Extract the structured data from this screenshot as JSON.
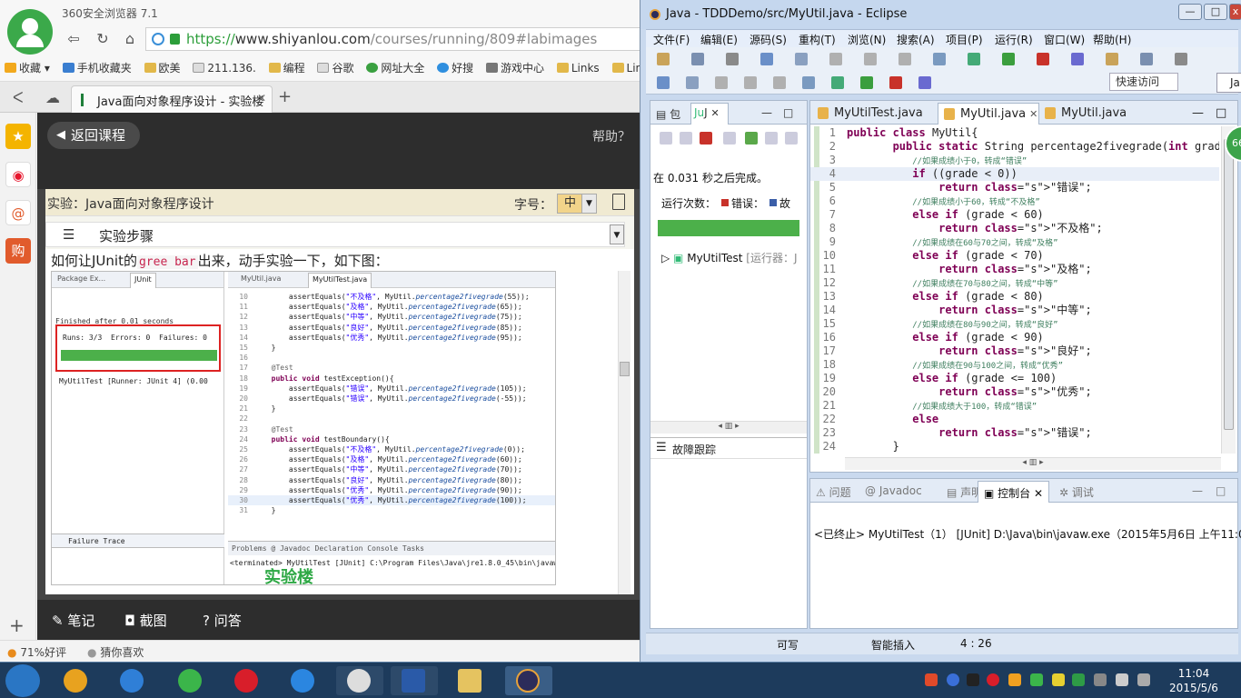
{
  "browser": {
    "app_name": "360安全浏览器 7.1",
    "url": {
      "scheme": "https://",
      "host": "www.shiyanlou.com",
      "path": "/courses/running/809#labimages"
    },
    "bookmarks": [
      "收藏",
      "手机收藏夹",
      "欧美",
      "211.136.",
      "编程",
      "谷歌",
      "网址大全",
      "好搜",
      "游戏中心",
      "Links",
      "Link"
    ],
    "tab_title": "Java面向对象程序设计 - 实验楼",
    "status": {
      "rating": "71%好评",
      "guess": "猜你喜欢"
    }
  },
  "page": {
    "back_button": "返回课程",
    "help": "帮助？",
    "experiment_title": "实验：Java面向对象程序设计",
    "font_size_label": "字号：",
    "font_size_value": "中",
    "steps_label": "实验步骤",
    "intro_before": "如何让JUnit的",
    "intro_code": "gree bar",
    "intro_after": "出来，动手实验一下，如下图：",
    "bottom": {
      "notes": "笔记",
      "screenshot": "截图",
      "qa": "问答"
    }
  },
  "embedded": {
    "tab_left_1": "Package Ex...",
    "tab_left_2": "JUnit",
    "tab_right_1": "MyUtil.java",
    "tab_right_2": "MyUtilTest.java",
    "finished": "Finished after 0.01 seconds",
    "runs": "Runs:  3/3",
    "errors": "Errors:  0",
    "failures": "Failures:  0",
    "tree_item": "MyUtilTest [Runner: JUnit 4] (0.00",
    "failure_trace": "Failure Trace",
    "console_tabs": "Problems  @ Javadoc  Declaration  Console  Tasks",
    "console_line": "<terminated> MyUtilTest [JUnit] C:\\Program Files\\Java\\jre1.8.0_45\\bin\\javaw.exe",
    "watermark": "实验楼",
    "code_lines": [
      {
        "n": "10",
        "t": "assertEquals(\"不及格\", MyUtil.percentage2fivegrade(55));"
      },
      {
        "n": "11",
        "t": "assertEquals(\"及格\", MyUtil.percentage2fivegrade(65));"
      },
      {
        "n": "12",
        "t": "assertEquals(\"中等\", MyUtil.percentage2fivegrade(75));"
      },
      {
        "n": "13",
        "t": "assertEquals(\"良好\", MyUtil.percentage2fivegrade(85));"
      },
      {
        "n": "14",
        "t": "assertEquals(\"优秀\", MyUtil.percentage2fivegrade(95));"
      },
      {
        "n": "15",
        "t": "}"
      },
      {
        "n": "16",
        "t": ""
      },
      {
        "n": "17",
        "t": "@Test"
      },
      {
        "n": "18",
        "t": "public void testException(){"
      },
      {
        "n": "19",
        "t": "assertEquals(\"错误\", MyUtil.percentage2fivegrade(105));"
      },
      {
        "n": "20",
        "t": "assertEquals(\"错误\", MyUtil.percentage2fivegrade(-55));"
      },
      {
        "n": "21",
        "t": "}"
      },
      {
        "n": "22",
        "t": ""
      },
      {
        "n": "23",
        "t": "@Test"
      },
      {
        "n": "24",
        "t": "public void testBoundary(){"
      },
      {
        "n": "25",
        "t": "assertEquals(\"不及格\", MyUtil.percentage2fivegrade(0));"
      },
      {
        "n": "26",
        "t": "assertEquals(\"及格\", MyUtil.percentage2fivegrade(60));"
      },
      {
        "n": "27",
        "t": "assertEquals(\"中等\", MyUtil.percentage2fivegrade(70));"
      },
      {
        "n": "28",
        "t": "assertEquals(\"良好\", MyUtil.percentage2fivegrade(80));"
      },
      {
        "n": "29",
        "t": "assertEquals(\"优秀\", MyUtil.percentage2fivegrade(90));"
      },
      {
        "n": "30",
        "t": "assertEquals(\"优秀\", MyUtil.percentage2fivegrade(100));"
      },
      {
        "n": "31",
        "t": "}"
      }
    ]
  },
  "eclipse": {
    "title": "Java - TDDDemo/src/MyUtil.java - Eclipse",
    "menu": [
      "文件(F)",
      "编辑(E)",
      "源码(S)",
      "重构(T)",
      "浏览(N)",
      "搜索(A)",
      "项目(P)",
      "运行(R)",
      "窗口(W)",
      "帮助(H)"
    ],
    "quick_access": "快速访问",
    "perspective": "Ja",
    "left_tabs": {
      "package": "包",
      "junit": "J"
    },
    "junit": {
      "status": "在 0.031 秒之后完成。",
      "runs_label": "运行次数：",
      "errors_label": "错误：",
      "failures_label": "故",
      "tree_item": "MyUtilTest",
      "tree_sub": "[运行器：J",
      "failure_trace": "故障跟踪"
    },
    "editor_tabs": [
      "MyUtilTest.java",
      "MyUtil.java",
      "MyUtil.java"
    ],
    "code": [
      {
        "n": "1",
        "t": "public class MyUtil{"
      },
      {
        "n": "2",
        "t": "       public static String percentage2fivegrade(int grad"
      },
      {
        "n": "3",
        "t": "          //如果成绩小于0，转成“错误”"
      },
      {
        "n": "4",
        "t": "          if ((grade < 0))"
      },
      {
        "n": "5",
        "t": "              return \"错误\";"
      },
      {
        "n": "6",
        "t": "          //如果成绩小于60，转成“不及格”"
      },
      {
        "n": "7",
        "t": "          else if (grade < 60)"
      },
      {
        "n": "8",
        "t": "              return \"不及格\";"
      },
      {
        "n": "9",
        "t": "          //如果成绩在60与70之间，转成“及格”"
      },
      {
        "n": "10",
        "t": "          else if (grade < 70)"
      },
      {
        "n": "11",
        "t": "              return \"及格\";"
      },
      {
        "n": "12",
        "t": "          //如果成绩在70与80之间，转成“中等”"
      },
      {
        "n": "13",
        "t": "          else if (grade < 80)"
      },
      {
        "n": "14",
        "t": "              return \"中等\";"
      },
      {
        "n": "15",
        "t": "          //如果成绩在80与90之间，转成“良好”"
      },
      {
        "n": "16",
        "t": "          else if (grade < 90)"
      },
      {
        "n": "17",
        "t": "              return \"良好\";"
      },
      {
        "n": "18",
        "t": "          //如果成绩在90与100之间，转成“优秀”"
      },
      {
        "n": "19",
        "t": "          else if (grade <= 100)"
      },
      {
        "n": "20",
        "t": "              return \"优秀\";"
      },
      {
        "n": "21",
        "t": "          //如果成绩大于100，转成“错误”"
      },
      {
        "n": "22",
        "t": "          else"
      },
      {
        "n": "23",
        "t": "              return \"错误\";"
      },
      {
        "n": "24",
        "t": "       }"
      }
    ],
    "console_tabs": {
      "problems": "问题",
      "javadoc": "Javadoc",
      "declaration": "声明",
      "console": "控制台",
      "debug": "调试"
    },
    "console_line": "<已终止> MyUtilTest（1） [JUnit] D:\\Java\\bin\\javaw.exe（2015年5月6日 上午11:04:",
    "status": {
      "writable": "可写",
      "insert": "智能插入",
      "position": "4 : 26"
    },
    "badge": "66"
  },
  "taskbar": {
    "time": "11:04",
    "date": "2015/5/6"
  }
}
